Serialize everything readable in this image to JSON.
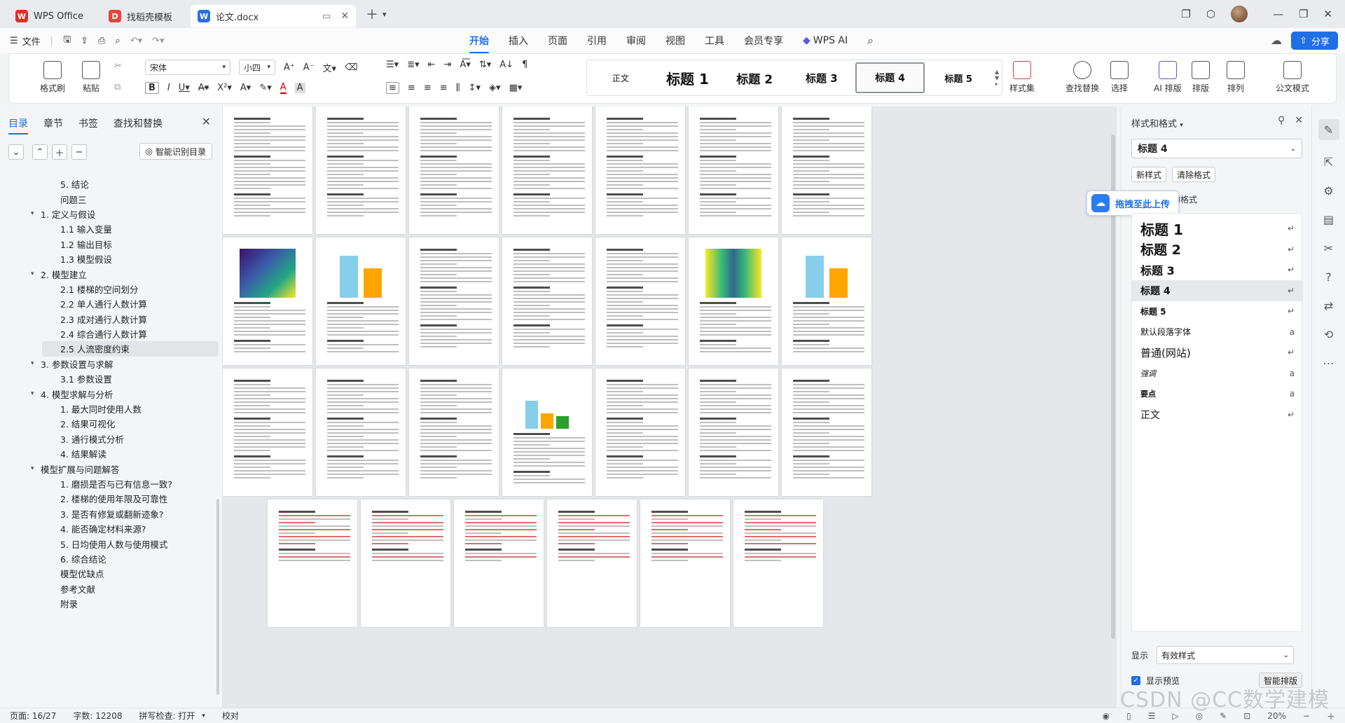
{
  "titlebar": {
    "tabs": [
      {
        "label": "WPS Office",
        "color": "#d8322b"
      },
      {
        "label": "找稻壳模板",
        "color": "#e6453a"
      },
      {
        "label": "论文.docx",
        "color": "#2b6fe0"
      }
    ]
  },
  "menubar": {
    "file_label": "文件",
    "tabs": [
      "开始",
      "插入",
      "页面",
      "引用",
      "审阅",
      "视图",
      "工具",
      "会员专享",
      "WPS AI"
    ],
    "share_label": "分享"
  },
  "ribbon": {
    "format_painter": "格式刷",
    "paste": "粘贴",
    "font_name": "宋体",
    "font_size": "小四",
    "styles": [
      "正文",
      "标题 1",
      "标题 2",
      "标题 3",
      "标题 4",
      "标题 5"
    ],
    "style_set": "样式集",
    "find_replace": "查找替换",
    "select": "选择",
    "ai_layout": "AI 排版",
    "layout": "排版",
    "arrange": "排列",
    "doc_format": "公文模式"
  },
  "nav": {
    "tabs": [
      "目录",
      "章节",
      "书签",
      "查找和替换"
    ],
    "smart_toc": "智能识别目录",
    "items": [
      {
        "label": "5. 结论",
        "level": 2
      },
      {
        "label": "问题三",
        "level": 2
      },
      {
        "label": "1. 定义与假设",
        "level": 1
      },
      {
        "label": "1.1 输入变量",
        "level": 2
      },
      {
        "label": "1.2 输出目标",
        "level": 2
      },
      {
        "label": "1.3 模型假设",
        "level": 2
      },
      {
        "label": "2. 模型建立",
        "level": 1
      },
      {
        "label": "2.1 楼梯的空间划分",
        "level": 2
      },
      {
        "label": "2.2 单人通行人数计算",
        "level": 2
      },
      {
        "label": "2.3 成对通行人数计算",
        "level": 2
      },
      {
        "label": "2.4 综合通行人数计算",
        "level": 2
      },
      {
        "label": "2.5 人流密度约束",
        "level": 2
      },
      {
        "label": "3. 参数设置与求解",
        "level": 1
      },
      {
        "label": "3.1 参数设置",
        "level": 2
      },
      {
        "label": "4. 模型求解与分析",
        "level": 1
      },
      {
        "label": "1. 最大同时使用人数",
        "level": 2
      },
      {
        "label": "2. 结果可视化",
        "level": 2
      },
      {
        "label": "3. 通行模式分析",
        "level": 2
      },
      {
        "label": "4. 结果解读",
        "level": 2
      },
      {
        "label": "模型扩展与问题解答",
        "level": 1
      },
      {
        "label": "1. 磨损是否与已有信息一致?",
        "level": 2
      },
      {
        "label": "2. 楼梯的使用年限及可靠性",
        "level": 2
      },
      {
        "label": "3. 是否有修复或翻新迹象?",
        "level": 2
      },
      {
        "label": "4. 能否确定材料来源?",
        "level": 2
      },
      {
        "label": "5. 日均使用人数与使用模式",
        "level": 2
      },
      {
        "label": "6. 综合结论",
        "level": 2
      },
      {
        "label": "模型优缺点",
        "level": 2
      },
      {
        "label": "参考文献",
        "level": 2
      },
      {
        "label": "附录",
        "level": 2
      }
    ]
  },
  "stylepane": {
    "title": "样式和格式",
    "current_style": "标题 4",
    "new_style": "新样式",
    "clear_format": "清除格式",
    "used_label": "用的格式",
    "upload_badge": "拖拽至此上传",
    "list": [
      "标题 1",
      "标题 2",
      "标题 3",
      "标题 4",
      "标题 5",
      "默认段落字体",
      "普通(网站)",
      "强调",
      "要点",
      "正文"
    ],
    "show_label": "显示",
    "show_value": "有效样式",
    "preview_label": "显示预览",
    "style_check": "智能排版"
  },
  "status": {
    "page": "页面: 16/27",
    "words": "字数: 12208",
    "spell": "拼写检查: 打开",
    "proof": "校对",
    "zoom": "20%"
  },
  "watermark": "CSDN @CC数学建模"
}
